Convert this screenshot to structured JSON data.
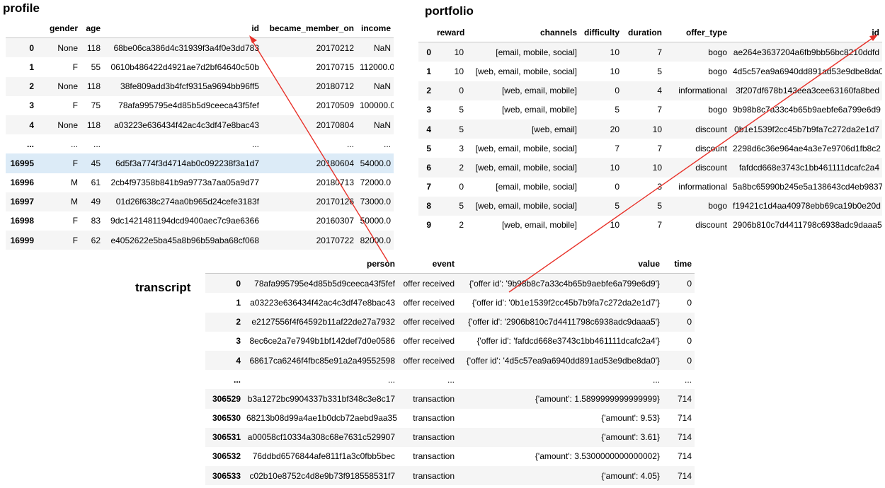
{
  "titles": {
    "profile": "profile",
    "portfolio": "portfolio",
    "transcript": "transcript"
  },
  "colors": {
    "arrow": "#e8322a",
    "highlight_row": "#dcebf7",
    "stripe": "#f5f5f5"
  },
  "profile": {
    "columns": [
      "",
      "gender",
      "age",
      "id",
      "became_member_on",
      "income"
    ],
    "rows": [
      [
        "0",
        "None",
        "118",
        "68be06ca386d4c31939f3a4f0e3dd783",
        "20170212",
        "NaN"
      ],
      [
        "1",
        "F",
        "55",
        "0610b486422d4921ae7d2bf64640c50b",
        "20170715",
        "112000.0"
      ],
      [
        "2",
        "None",
        "118",
        "38fe809add3b4fcf9315a9694bb96ff5",
        "20180712",
        "NaN"
      ],
      [
        "3",
        "F",
        "75",
        "78afa995795e4d85b5d9ceeca43f5fef",
        "20170509",
        "100000.0"
      ],
      [
        "4",
        "None",
        "118",
        "a03223e636434f42ac4c3df47e8bac43",
        "20170804",
        "NaN"
      ],
      [
        "...",
        "...",
        "...",
        "...",
        "...",
        "..."
      ],
      [
        "16995",
        "F",
        "45",
        "6d5f3a774f3d4714ab0c092238f3a1d7",
        "20180604",
        "54000.0"
      ],
      [
        "16996",
        "M",
        "61",
        "2cb4f97358b841b9a9773a7aa05a9d77",
        "20180713",
        "72000.0"
      ],
      [
        "16997",
        "M",
        "49",
        "01d26f638c274aa0b965d24cefe3183f",
        "20170126",
        "73000.0"
      ],
      [
        "16998",
        "F",
        "83",
        "9dc1421481194dcd9400aec7c9ae6366",
        "20160307",
        "50000.0"
      ],
      [
        "16999",
        "F",
        "62",
        "e4052622e5ba45a8b96b59aba68cf068",
        "20170722",
        "82000.0"
      ]
    ]
  },
  "portfolio": {
    "columns": [
      "",
      "reward",
      "channels",
      "difficulty",
      "duration",
      "offer_type",
      "id"
    ],
    "rows": [
      [
        "0",
        "10",
        "[email, mobile, social]",
        "10",
        "7",
        "bogo",
        "ae264e3637204a6fb9bb56bc8210ddfd"
      ],
      [
        "1",
        "10",
        "[web, email, mobile, social]",
        "10",
        "5",
        "bogo",
        "4d5c57ea9a6940dd891ad53e9dbe8da0"
      ],
      [
        "2",
        "0",
        "[web, email, mobile]",
        "0",
        "4",
        "informational",
        "3f207df678b143eea3cee63160fa8bed"
      ],
      [
        "3",
        "5",
        "[web, email, mobile]",
        "5",
        "7",
        "bogo",
        "9b98b8c7a33c4b65b9aebfe6a799e6d9"
      ],
      [
        "4",
        "5",
        "[web, email]",
        "20",
        "10",
        "discount",
        "0b1e1539f2cc45b7b9fa7c272da2e1d7"
      ],
      [
        "5",
        "3",
        "[web, email, mobile, social]",
        "7",
        "7",
        "discount",
        "2298d6c36e964ae4a3e7e9706d1fb8c2"
      ],
      [
        "6",
        "2",
        "[web, email, mobile, social]",
        "10",
        "10",
        "discount",
        "fafdcd668e3743c1bb461111dcafc2a4"
      ],
      [
        "7",
        "0",
        "[email, mobile, social]",
        "0",
        "3",
        "informational",
        "5a8bc65990b245e5a138643cd4eb9837"
      ],
      [
        "8",
        "5",
        "[web, email, mobile, social]",
        "5",
        "5",
        "bogo",
        "f19421c1d4aa40978ebb69ca19b0e20d"
      ],
      [
        "9",
        "2",
        "[web, email, mobile]",
        "10",
        "7",
        "discount",
        "2906b810c7d4411798c6938adc9daaa5"
      ]
    ]
  },
  "transcript": {
    "columns": [
      "",
      "person",
      "event",
      "value",
      "time"
    ],
    "rows": [
      [
        "0",
        "78afa995795e4d85b5d9ceeca43f5fef",
        "offer received",
        "{'offer id': '9b98b8c7a33c4b65b9aebfe6a799e6d9'}",
        "0"
      ],
      [
        "1",
        "a03223e636434f42ac4c3df47e8bac43",
        "offer received",
        "{'offer id': '0b1e1539f2cc45b7b9fa7c272da2e1d7'}",
        "0"
      ],
      [
        "2",
        "e2127556f4f64592b11af22de27a7932",
        "offer received",
        "{'offer id': '2906b810c7d4411798c6938adc9daaa5'}",
        "0"
      ],
      [
        "3",
        "8ec6ce2a7e7949b1bf142def7d0e0586",
        "offer received",
        "{'offer id': 'fafdcd668e3743c1bb461111dcafc2a4'}",
        "0"
      ],
      [
        "4",
        "68617ca6246f4fbc85e91a2a49552598",
        "offer received",
        "{'offer id': '4d5c57ea9a6940dd891ad53e9dbe8da0'}",
        "0"
      ],
      [
        "...",
        "...",
        "...",
        "...",
        "..."
      ],
      [
        "306529",
        "b3a1272bc9904337b331bf348c3e8c17",
        "transaction",
        "{'amount': 1.5899999999999999}",
        "714"
      ],
      [
        "306530",
        "68213b08d99a4ae1b0dcb72aebd9aa35",
        "transaction",
        "{'amount': 9.53}",
        "714"
      ],
      [
        "306531",
        "a00058cf10334a308c68e7631c529907",
        "transaction",
        "{'amount': 3.61}",
        "714"
      ],
      [
        "306532",
        "76ddbd6576844afe811f1a3c0fbb5bec",
        "transaction",
        "{'amount': 3.5300000000000002}",
        "714"
      ],
      [
        "306533",
        "c02b10e8752c4d8e9b73f918558531f7",
        "transaction",
        "{'amount': 4.05}",
        "714"
      ]
    ]
  }
}
